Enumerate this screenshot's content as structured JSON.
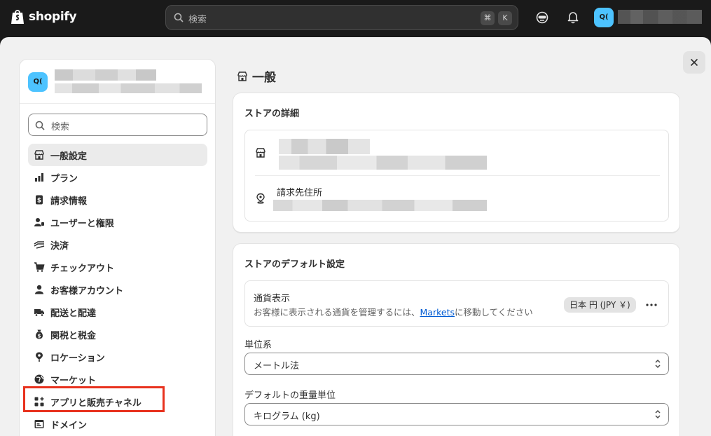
{
  "topbar": {
    "logo_text": "shopify",
    "search_placeholder": "検索",
    "shortcut_cmd": "⌘",
    "shortcut_key": "K",
    "avatar_initials": "Q("
  },
  "sidebar": {
    "avatar_initials": "Q(",
    "search_placeholder": "検索",
    "items": [
      {
        "label": "一般設定",
        "icon": "store-icon",
        "active": true
      },
      {
        "label": "プラン",
        "icon": "plan-chart-icon"
      },
      {
        "label": "請求情報",
        "icon": "billing-icon"
      },
      {
        "label": "ユーザーと権限",
        "icon": "users-icon"
      },
      {
        "label": "決済",
        "icon": "payments-icon"
      },
      {
        "label": "チェックアウト",
        "icon": "cart-icon"
      },
      {
        "label": "お客様アカウント",
        "icon": "person-icon"
      },
      {
        "label": "配送と配達",
        "icon": "truck-icon"
      },
      {
        "label": "関税と税金",
        "icon": "tax-bag-icon"
      },
      {
        "label": "ロケーション",
        "icon": "location-icon"
      },
      {
        "label": "マーケット",
        "icon": "globe-icon"
      },
      {
        "label": "アプリと販売チャネル",
        "icon": "apps-icon"
      },
      {
        "label": "ドメイン",
        "icon": "domain-icon"
      }
    ]
  },
  "page": {
    "title": "一般"
  },
  "store_details": {
    "title": "ストアの詳細",
    "billing_address_label": "請求先住所"
  },
  "store_defaults": {
    "title": "ストアのデフォルト設定",
    "currency_label": "通貨表示",
    "currency_desc_before": "お客様に表示される通貨を管理するには、",
    "currency_desc_link": "Markets",
    "currency_desc_after": "に移動してください",
    "currency_badge": "日本 円 (JPY ￥)",
    "unit_system_label": "単位系",
    "unit_system_value": "メートル法",
    "weight_unit_label": "デフォルトの重量単位",
    "weight_unit_value": "キログラム (kg)"
  },
  "colors": {
    "accent": "#4dc3ff",
    "link": "#005bd3",
    "highlight": "#e8321e"
  }
}
